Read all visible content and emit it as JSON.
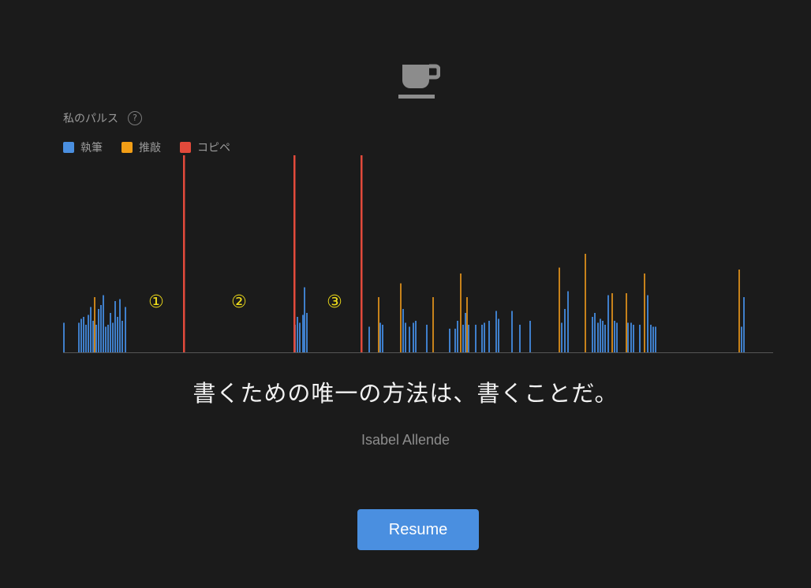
{
  "header": {
    "icon": "coffee-cup-icon",
    "pulse_label": "私のパルス",
    "help_symbol": "?"
  },
  "legend": [
    {
      "label": "執筆",
      "color": "#4a8fe0"
    },
    {
      "label": "推敲",
      "color": "#f29e16"
    },
    {
      "label": "コピペ",
      "color": "#e24a3b"
    }
  ],
  "chart_data": {
    "type": "bar",
    "colors": {
      "writing": "#3f7fcb",
      "editing": "#c7821b",
      "paste": "#e24a3b"
    },
    "markers": [
      "①",
      "②",
      "③"
    ],
    "marker_color": "#f0dd1a",
    "ylim": [
      0,
      100
    ],
    "bars": [
      [
        80,
        "w",
        15
      ],
      [
        99,
        "w",
        15
      ],
      [
        102,
        "w",
        17
      ],
      [
        105,
        "w",
        18
      ],
      [
        108,
        "w",
        14
      ],
      [
        111,
        "w",
        19
      ],
      [
        114,
        "w",
        23
      ],
      [
        117,
        "w",
        16
      ],
      [
        119,
        "e",
        28
      ],
      [
        121,
        "w",
        14
      ],
      [
        124,
        "w",
        22
      ],
      [
        127,
        "w",
        24
      ],
      [
        130,
        "w",
        29
      ],
      [
        133,
        "w",
        13
      ],
      [
        136,
        "w",
        14
      ],
      [
        139,
        "w",
        20
      ],
      [
        142,
        "w",
        15
      ],
      [
        145,
        "w",
        26
      ],
      [
        148,
        "w",
        18
      ],
      [
        151,
        "w",
        27
      ],
      [
        154,
        "w",
        16
      ],
      [
        158,
        "w",
        23
      ],
      [
        232,
        "p",
        100
      ],
      [
        372,
        "p",
        100
      ],
      [
        457,
        "p",
        100
      ],
      [
        373,
        "w",
        14
      ],
      [
        376,
        "w",
        18
      ],
      [
        379,
        "w",
        15
      ],
      [
        383,
        "w",
        19
      ],
      [
        385,
        "w",
        33
      ],
      [
        388,
        "w",
        20
      ],
      [
        467,
        "w",
        13
      ],
      [
        479,
        "e",
        28
      ],
      [
        481,
        "w",
        15
      ],
      [
        484,
        "w",
        14
      ],
      [
        507,
        "e",
        35
      ],
      [
        510,
        "w",
        22
      ],
      [
        513,
        "w",
        15
      ],
      [
        518,
        "w",
        13
      ],
      [
        523,
        "w",
        15
      ],
      [
        526,
        "w",
        16
      ],
      [
        540,
        "w",
        14
      ],
      [
        548,
        "e",
        28
      ],
      [
        569,
        "w",
        12
      ],
      [
        576,
        "w",
        12
      ],
      [
        579,
        "w",
        16
      ],
      [
        583,
        "e",
        40
      ],
      [
        586,
        "w",
        14
      ],
      [
        589,
        "w",
        20
      ],
      [
        591,
        "e",
        28
      ],
      [
        593,
        "w",
        14
      ],
      [
        602,
        "w",
        14
      ],
      [
        610,
        "w",
        14
      ],
      [
        613,
        "w",
        15
      ],
      [
        619,
        "w",
        16
      ],
      [
        628,
        "w",
        21
      ],
      [
        631,
        "w",
        17
      ],
      [
        648,
        "w",
        21
      ],
      [
        658,
        "w",
        14
      ],
      [
        671,
        "w",
        16
      ],
      [
        708,
        "e",
        43
      ],
      [
        711,
        "w",
        15
      ],
      [
        715,
        "w",
        22
      ],
      [
        719,
        "w",
        31
      ],
      [
        741,
        "e",
        50
      ],
      [
        750,
        "w",
        18
      ],
      [
        753,
        "w",
        20
      ],
      [
        757,
        "w",
        15
      ],
      [
        760,
        "w",
        17
      ],
      [
        763,
        "w",
        16
      ],
      [
        766,
        "w",
        14
      ],
      [
        770,
        "w",
        29
      ],
      [
        775,
        "e",
        30
      ],
      [
        778,
        "w",
        16
      ],
      [
        781,
        "w",
        15
      ],
      [
        793,
        "e",
        30
      ],
      [
        795,
        "w",
        15
      ],
      [
        799,
        "w",
        15
      ],
      [
        802,
        "w",
        14
      ],
      [
        810,
        "w",
        14
      ],
      [
        816,
        "e",
        40
      ],
      [
        820,
        "w",
        29
      ],
      [
        824,
        "w",
        14
      ],
      [
        827,
        "w",
        13
      ],
      [
        830,
        "w",
        13
      ],
      [
        936,
        "e",
        42
      ],
      [
        939,
        "w",
        13
      ],
      [
        942,
        "w",
        28
      ]
    ]
  },
  "quote": {
    "text": "書くための唯一の方法は、書くことだ。",
    "author": "Isabel Allende"
  },
  "actions": {
    "resume_label": "Resume"
  }
}
